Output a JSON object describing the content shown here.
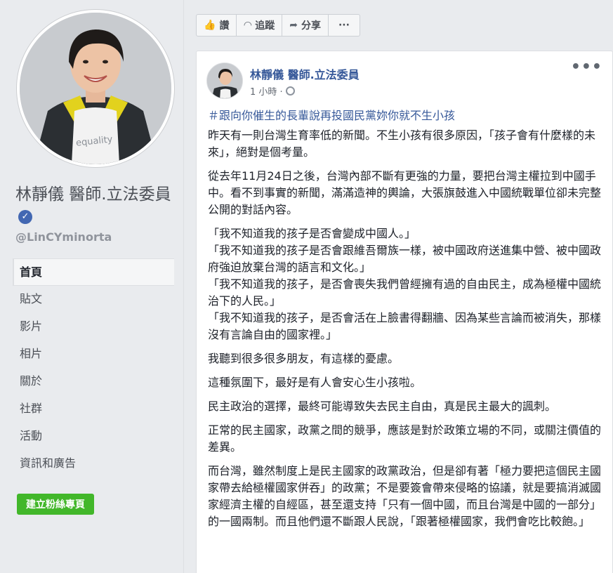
{
  "profile": {
    "name": "林靜儀 醫師.立法委員",
    "handle": "@LinCYminorta",
    "shirt_text": "equality"
  },
  "nav": {
    "items": [
      "首頁",
      "貼文",
      "影片",
      "相片",
      "關於",
      "社群",
      "活動",
      "資訊和廣告"
    ],
    "create_button": "建立粉絲專頁"
  },
  "actions": {
    "like": "讚",
    "follow": "追蹤",
    "share": "分享",
    "more": "···"
  },
  "post": {
    "author": "林靜儀 醫師.立法委員",
    "time": "1 小時 ·",
    "hashtag": "＃跟向你催生的長輩說再投國民黨妳你就不生小孩",
    "paragraphs": [
      "昨天有一則台灣生育率低的新聞。不生小孩有很多原因，「孩子會有什麼樣的未來」，絕對是個考量。",
      "從去年11月24日之後，台灣內部不斷有更強的力量，要把台灣主權拉到中國手中。看不到事實的新聞，滿滿造神的輿論，大張旗鼓進入中國統戰單位卻未完整公開的對話內容。"
    ],
    "quotes": [
      "「我不知道我的孩子是否會變成中國人。」",
      "「我不知道我的孩子是否會跟維吾爾族一樣，被中國政府送進集中營、被中國政府強迫放棄台灣的語言和文化。」",
      "「我不知道我的孩子，是否會喪失我們曾經擁有過的自由民主，成為極權中國統治下的人民。」",
      "「我不知道我的孩子，是否會活在上臉書得翻牆、因為某些言論而被消失，那樣沒有言論自由的國家裡。」"
    ],
    "paragraphs2": [
      "我聽到很多很多朋友，有這樣的憂慮。",
      "這種氛圍下，最好是有人會安心生小孩啦。",
      "民主政治的選擇，最終可能導致失去民主自由，真是民主最大的諷刺。",
      "正常的民主國家，政黨之間的競爭，應該是對於政策立場的不同，或關注價值的差異。",
      "而台灣，雖然制度上是民主國家的政黨政治，但是卻有著「極力要把這個民主國家帶去給極權國家併吞」的政黨；不是要簽會帶來侵略的協議，就是要搞消滅國家經濟主權的自經區，甚至還支持「只有一個中國，而且台灣是中國的一部分」的一國兩制。而且他們還不斷跟人民說，「跟著極權國家，我們會吃比較飽。」"
    ]
  }
}
